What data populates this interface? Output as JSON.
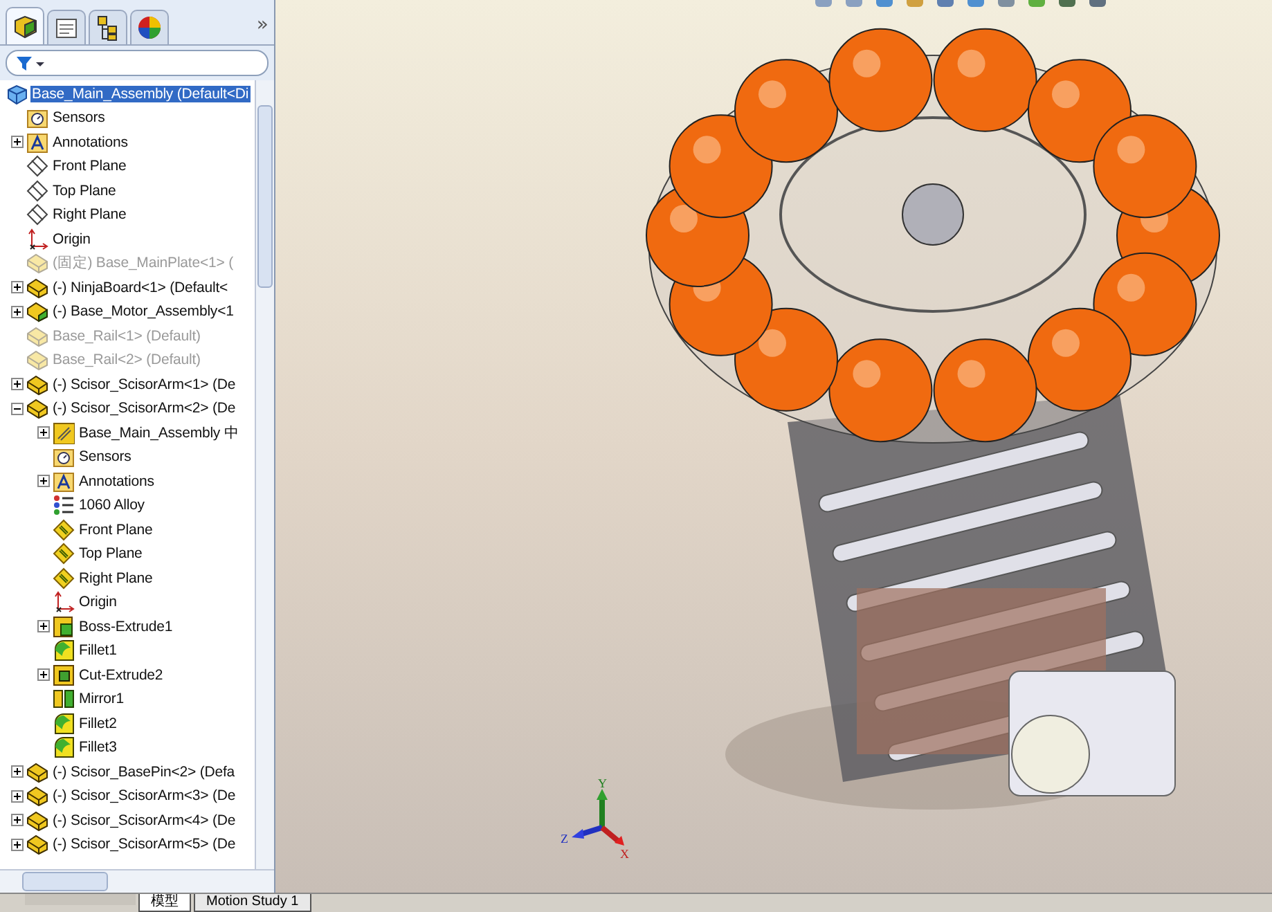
{
  "panel_tabs": [
    {
      "kind": "feature",
      "selected": true
    },
    {
      "kind": "property",
      "selected": false
    },
    {
      "kind": "config",
      "selected": false
    },
    {
      "kind": "display",
      "selected": false
    }
  ],
  "panel_more": "»",
  "tree": [
    {
      "text": "Base_Main_Assembly  (Default<Di",
      "kind": "assembly",
      "selected": true,
      "suppressed": false,
      "expandable": false,
      "children": [
        {
          "text": "Sensors",
          "kind": "sensor",
          "selected": false,
          "suppressed": false,
          "expandable": false
        },
        {
          "text": "Annotations",
          "kind": "annotation",
          "selected": false,
          "suppressed": false,
          "expandable": true,
          "expanded": false
        },
        {
          "text": "Front Plane",
          "kind": "plane",
          "selected": false,
          "suppressed": false,
          "expandable": false
        },
        {
          "text": "Top Plane",
          "kind": "plane",
          "selected": false,
          "suppressed": false,
          "expandable": false
        },
        {
          "text": "Right Plane",
          "kind": "plane",
          "selected": false,
          "suppressed": false,
          "expandable": false
        },
        {
          "text": "Origin",
          "kind": "origin",
          "selected": false,
          "suppressed": false,
          "expandable": false
        },
        {
          "text": "(固定) Base_MainPlate<1> (",
          "kind": "part",
          "selected": false,
          "suppressed": true,
          "expandable": false
        },
        {
          "text": "(-) NinjaBoard<1> (Default<",
          "kind": "part",
          "selected": false,
          "suppressed": false,
          "expandable": true,
          "expanded": false
        },
        {
          "text": "(-) Base_Motor_Assembly<1",
          "kind": "subassembly",
          "selected": false,
          "suppressed": false,
          "expandable": true,
          "expanded": false
        },
        {
          "text": "Base_Rail<1> (Default)",
          "kind": "part",
          "selected": false,
          "suppressed": true,
          "expandable": false
        },
        {
          "text": "Base_Rail<2> (Default)",
          "kind": "part",
          "selected": false,
          "suppressed": true,
          "expandable": false
        },
        {
          "text": "(-) Scisor_ScisorArm<1> (De",
          "kind": "part",
          "selected": false,
          "suppressed": false,
          "expandable": true,
          "expanded": false
        },
        {
          "text": "(-) Scisor_ScisorArm<2> (De",
          "kind": "part",
          "selected": false,
          "suppressed": false,
          "expandable": true,
          "expanded": true,
          "children": [
            {
              "text": "Base_Main_Assembly 中",
              "kind": "history",
              "selected": false,
              "suppressed": false,
              "expandable": true,
              "expanded": false
            },
            {
              "text": "Sensors",
              "kind": "sensor",
              "selected": false,
              "suppressed": false,
              "expandable": false
            },
            {
              "text": "Annotations",
              "kind": "annotation",
              "selected": false,
              "suppressed": false,
              "expandable": true,
              "expanded": false
            },
            {
              "text": "1060 Alloy",
              "kind": "material",
              "selected": false,
              "suppressed": false,
              "expandable": false
            },
            {
              "text": "Front Plane",
              "kind": "partplane",
              "selected": false,
              "suppressed": false,
              "expandable": false
            },
            {
              "text": "Top Plane",
              "kind": "partplane",
              "selected": false,
              "suppressed": false,
              "expandable": false
            },
            {
              "text": "Right Plane",
              "kind": "partplane",
              "selected": false,
              "suppressed": false,
              "expandable": false
            },
            {
              "text": "Origin",
              "kind": "origin",
              "selected": false,
              "suppressed": false,
              "expandable": false
            },
            {
              "text": "Boss-Extrude1",
              "kind": "extrude",
              "selected": false,
              "suppressed": false,
              "expandable": true,
              "expanded": false
            },
            {
              "text": "Fillet1",
              "kind": "fillet",
              "selected": false,
              "suppressed": false,
              "expandable": false
            },
            {
              "text": "Cut-Extrude2",
              "kind": "cut",
              "selected": false,
              "suppressed": false,
              "expandable": true,
              "expanded": false
            },
            {
              "text": "Mirror1",
              "kind": "mirror",
              "selected": false,
              "suppressed": false,
              "expandable": false
            },
            {
              "text": "Fillet2",
              "kind": "fillet",
              "selected": false,
              "suppressed": false,
              "expandable": false
            },
            {
              "text": "Fillet3",
              "kind": "fillet",
              "selected": false,
              "suppressed": false,
              "expandable": false
            }
          ]
        },
        {
          "text": "(-) Scisor_BasePin<2> (Defa",
          "kind": "part",
          "selected": false,
          "suppressed": false,
          "expandable": true,
          "expanded": false
        },
        {
          "text": "(-) Scisor_ScisorArm<3> (De",
          "kind": "part",
          "selected": false,
          "suppressed": false,
          "expandable": true,
          "expanded": false
        },
        {
          "text": "(-) Scisor_ScisorArm<4> (De",
          "kind": "part",
          "selected": false,
          "suppressed": false,
          "expandable": true,
          "expanded": false
        },
        {
          "text": "(-) Scisor_ScisorArm<5> (De",
          "kind": "part",
          "selected": false,
          "suppressed": false,
          "expandable": true,
          "expanded": false
        }
      ]
    }
  ],
  "bottom_tabs": [
    {
      "label": "模型",
      "selected": true
    },
    {
      "label": "Motion Study 1",
      "selected": false
    }
  ],
  "triad": {
    "x": "X",
    "y": "Y",
    "z": "Z"
  }
}
